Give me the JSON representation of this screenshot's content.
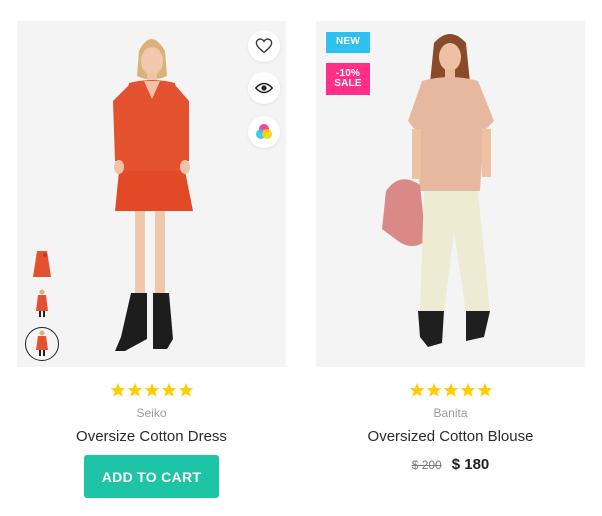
{
  "products": [
    {
      "brand": "Seiko",
      "name": "Oversize Cotton Dress",
      "rating": 5,
      "rating_max": 5,
      "cta_label": "ADD TO CART",
      "thumbnail_count": 3,
      "actions": [
        "heart-icon",
        "eye-icon",
        "color-swatch-icon"
      ]
    },
    {
      "brand": "Banita",
      "name": "Oversized Cotton Blouse",
      "rating": 5,
      "rating_max": 5,
      "badges": {
        "new": "NEW",
        "discount": "-10%",
        "sale": "SALE"
      },
      "price_old": "$ 200",
      "price_new": "$ 180"
    }
  ],
  "colors": {
    "star": "#ffcc00",
    "cart_button": "#1dc4a6",
    "badge_new": "#2ec1ee",
    "badge_sale": "#ff2e86",
    "media_bg": "#f4f4f4"
  }
}
